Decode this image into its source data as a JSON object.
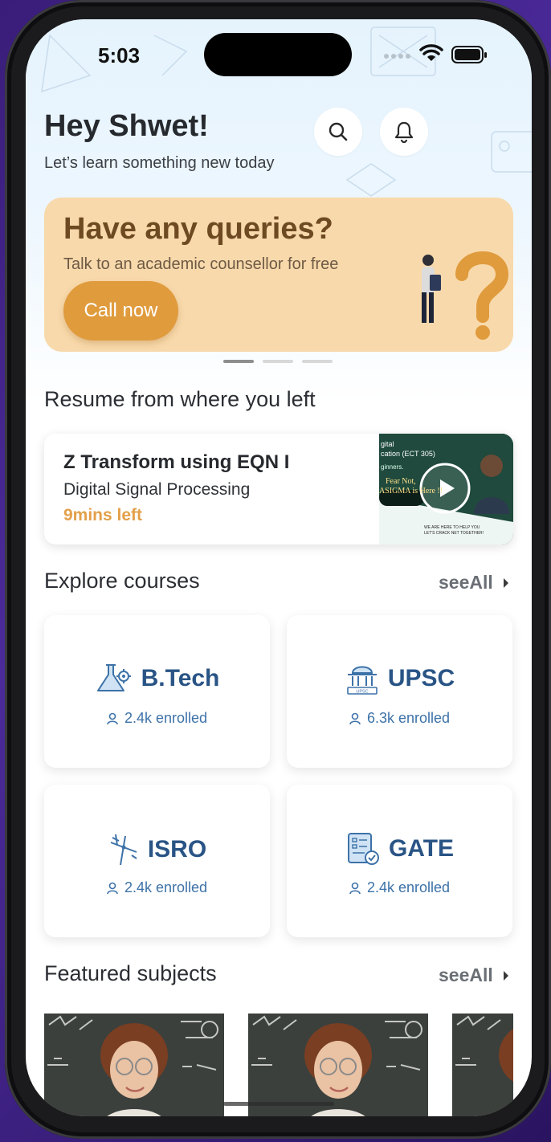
{
  "status_bar": {
    "time": "5:03"
  },
  "header": {
    "greeting": "Hey Shwet!",
    "subtitle": "Let’s learn something new today",
    "search_icon": "search-icon",
    "bell_icon": "bell-icon"
  },
  "promo": {
    "title": "Have any queries?",
    "subtitle": "Talk to an academic counsellor for free",
    "cta_label": "Call now",
    "pages": 3,
    "active_page": 1
  },
  "resume": {
    "section_title": "Resume from where you left",
    "lesson_title": "Z Transform using EQN I",
    "course": "Digital Signal Processing",
    "time_left": "9mins left",
    "thumb_lines": [
      "gital",
      "cation (ECT 305)",
      "ginners.",
      "Fear Not,",
      "ASIGMA is Here !!",
      "WE ARE HERE TO HELP YOU",
      "LET'S CRACK NET TOGETHER!"
    ]
  },
  "explore": {
    "section_title": "Explore courses",
    "see_all": "seeAll",
    "courses": [
      {
        "name": "B.Tech",
        "enrolled": "2.4k enrolled",
        "icon": "flask-gear-icon"
      },
      {
        "name": "UPSC",
        "enrolled": "6.3k enrolled",
        "icon": "upsc-building-icon"
      },
      {
        "name": "ISRO",
        "enrolled": "2.4k enrolled",
        "icon": "satellite-icon"
      },
      {
        "name": "GATE",
        "enrolled": "2.4k enrolled",
        "icon": "document-check-icon"
      }
    ]
  },
  "featured": {
    "section_title": "Featured subjects",
    "see_all": "seeAll"
  },
  "colors": {
    "promo_bg": "#f8d9ab",
    "promo_button": "#e09b3d",
    "accent_orange": "#e3a04a",
    "course_blue": "#295485"
  }
}
